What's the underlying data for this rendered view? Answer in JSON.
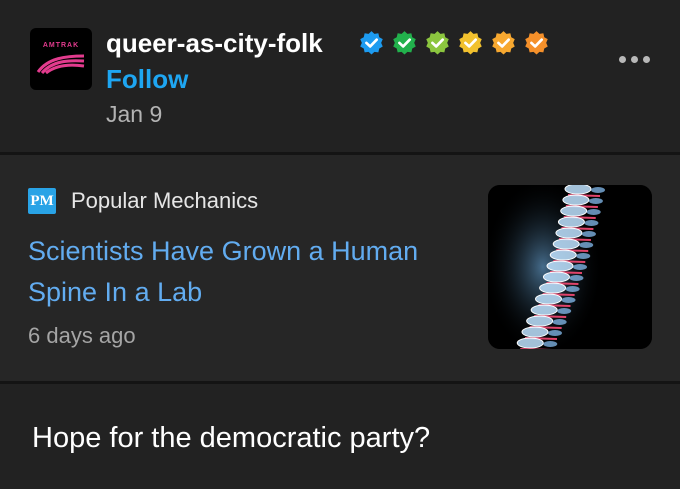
{
  "post": {
    "avatar_brand": "AMTRAK",
    "username": "queer-as-city-folk",
    "badges": [
      {
        "icon": "verified-badge-icon",
        "color": "#1d9bf0"
      },
      {
        "icon": "verified-badge-icon",
        "color": "#22b14c"
      },
      {
        "icon": "verified-badge-icon",
        "color": "#8cc63f"
      },
      {
        "icon": "verified-badge-icon",
        "color": "#f2c12e"
      },
      {
        "icon": "verified-badge-icon",
        "color": "#f7a830"
      },
      {
        "icon": "verified-badge-icon",
        "color": "#f5902a"
      }
    ],
    "follow_label": "Follow",
    "date": "Jan 9",
    "more_icon": "more-options-icon",
    "text": "Hope for the democratic party?"
  },
  "link_card": {
    "source_logo": "PM",
    "source_name": "Popular Mechanics",
    "headline": "Scientists Have Grown a Human Spine In a Lab",
    "age": "6 days ago",
    "thumbnail_icon": "spine-xray-image"
  },
  "colors": {
    "background": "#222222",
    "accent": "#1ea6f2",
    "headline": "#62acf0"
  }
}
